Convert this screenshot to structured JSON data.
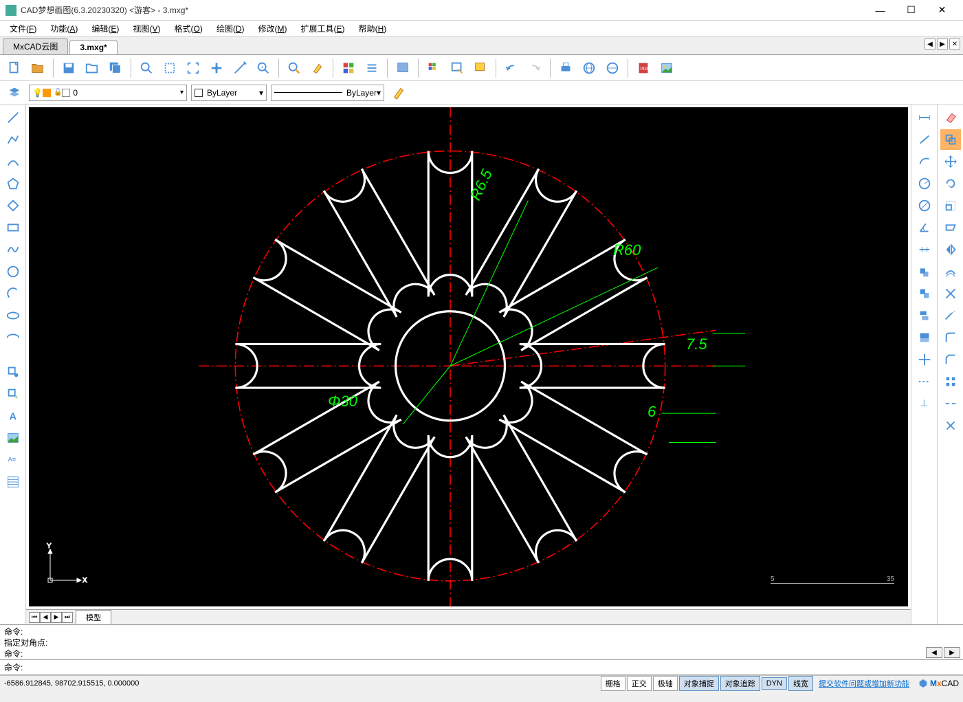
{
  "window": {
    "title": "CAD梦想画图(6.3.20230320) <游客> - 3.mxg*",
    "min": "—",
    "max": "☐",
    "close": "✕"
  },
  "menus": [
    {
      "label": "文件",
      "key": "F"
    },
    {
      "label": "功能",
      "key": "A"
    },
    {
      "label": "编辑",
      "key": "E"
    },
    {
      "label": "视图",
      "key": "V"
    },
    {
      "label": "格式",
      "key": "O"
    },
    {
      "label": "绘图",
      "key": "D"
    },
    {
      "label": "修改",
      "key": "M"
    },
    {
      "label": "扩展工具",
      "key": "E"
    },
    {
      "label": "帮助",
      "key": "H"
    }
  ],
  "tabs": [
    {
      "label": "MxCAD云图",
      "active": false
    },
    {
      "label": "3.mxg*",
      "active": true
    }
  ],
  "layer": {
    "current": "0",
    "color_label": "ByLayer",
    "linetype_label": "ByLayer"
  },
  "drawing": {
    "dims": {
      "r65": "R6.5",
      "r60": "R60",
      "d30": "Φ30",
      "a75": "7.5",
      "l6": "6"
    },
    "ruler": {
      "left": "5",
      "right": "35"
    }
  },
  "modeltab": "模型",
  "cmd": {
    "log": [
      "命令:",
      "指定对角点:",
      "命令:"
    ],
    "prompt": "命令:"
  },
  "status": {
    "coords": "-6586.912845,  98702.915515,  0.000000",
    "buttons": [
      {
        "label": "栅格",
        "active": false
      },
      {
        "label": "正交",
        "active": false
      },
      {
        "label": "极轴",
        "active": false
      },
      {
        "label": "对象捕捉",
        "active": true
      },
      {
        "label": "对象追踪",
        "active": true
      },
      {
        "label": "DYN",
        "active": true
      },
      {
        "label": "线宽",
        "active": true
      }
    ],
    "link": "提交软件问题或增加新功能",
    "logo": "MxCAD"
  },
  "icons": {
    "new": "new-file-icon",
    "open": "open-file-icon",
    "save": "save-icon",
    "folder": "folder-icon",
    "saveall": "save-all-icon",
    "zoomwin": "zoom-window-icon",
    "zoomall": "zoom-extents-icon",
    "zoomfull": "fullscreen-icon",
    "pan": "pan-icon",
    "measure": "measure-icon",
    "regen": "regen-icon",
    "find": "find-icon",
    "draworder": "draworder-icon",
    "props": "properties-icon",
    "list": "list-icon",
    "selwin": "select-window-icon",
    "grid": "grid-color-icon",
    "layersw": "layer-switch-icon",
    "layerstate": "layer-state-icon",
    "undo": "undo-icon",
    "redo": "redo-icon",
    "print": "print-icon",
    "web1": "web-icon",
    "web2": "web-icon",
    "pdf": "pdf-icon",
    "image": "image-icon",
    "layers": "layers-icon",
    "pencil": "pencil-icon"
  }
}
